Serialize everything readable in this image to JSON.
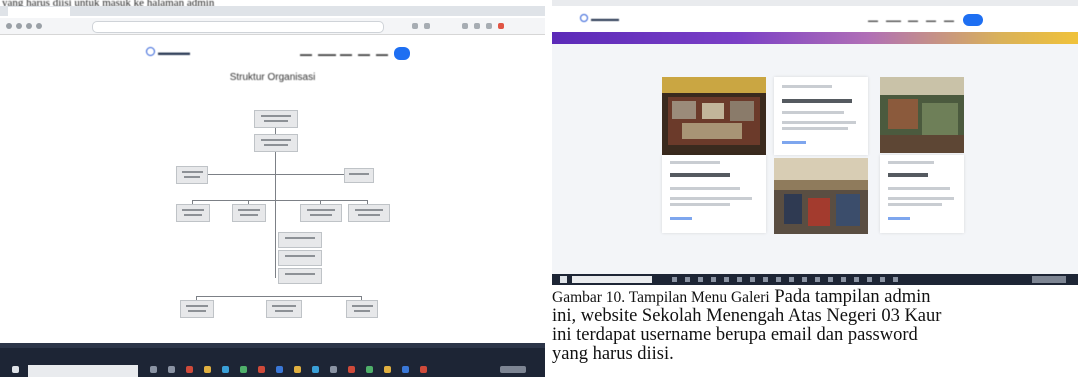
{
  "caption": {
    "figure_label": "Gambar 10. Tampilan Menu Galeri",
    "lines": [
      "Pada tampilan admin",
      "ini, website  Sekolah Menengah Atas Negeri 03 Kaur",
      "ini terdapat username berupa email dan password",
      "yang harus diisi."
    ]
  },
  "left_screenshot": {
    "top_caption": "yang harus diisi untuk masuk ke halaman admin",
    "page_title": "Struktur Organisasi"
  },
  "colors": {
    "accent_blue": "#1e6ff2",
    "taskbar": "#1d2535",
    "banner_start": "#5b2ab8",
    "banner_end": "#f0c23a"
  }
}
